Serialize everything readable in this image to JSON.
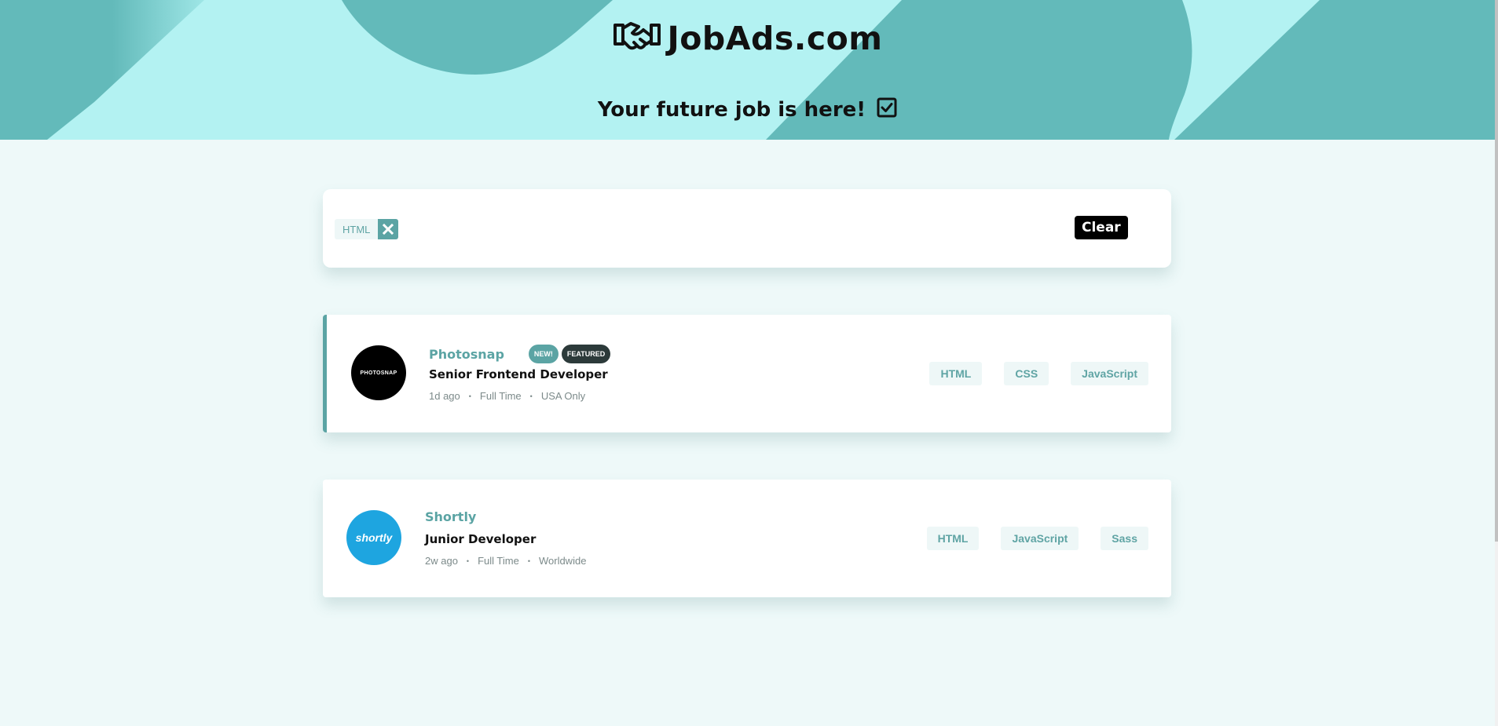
{
  "header": {
    "brand": "JobAds.com",
    "tagline": "Your future job is here!"
  },
  "colors": {
    "accent": "#5ba4a4",
    "header_light": "#b3f2f2",
    "header_dark": "#63baba",
    "background": "#eef9f9"
  },
  "filters": {
    "active": [
      {
        "label": "HTML"
      }
    ],
    "clear_label": "Clear"
  },
  "jobs": [
    {
      "company": "Photosnap",
      "logo_text": "PHOTOSNAP",
      "new_badge": "NEW!",
      "featured_badge": "FEATURED",
      "position": "Senior Frontend Developer",
      "posted": "1d ago",
      "contract": "Full Time",
      "location": "USA Only",
      "tags": [
        "HTML",
        "CSS",
        "JavaScript"
      ]
    },
    {
      "company": "Shortly",
      "logo_text": "shortly",
      "position": "Junior Developer",
      "posted": "2w ago",
      "contract": "Full Time",
      "location": "Worldwide",
      "tags": [
        "HTML",
        "JavaScript",
        "Sass"
      ]
    }
  ],
  "icons": {
    "brand_icon": "handshake-icon",
    "tagline_icon": "checkbox-icon",
    "remove_icon": "close-icon",
    "meta_separator": "•"
  }
}
